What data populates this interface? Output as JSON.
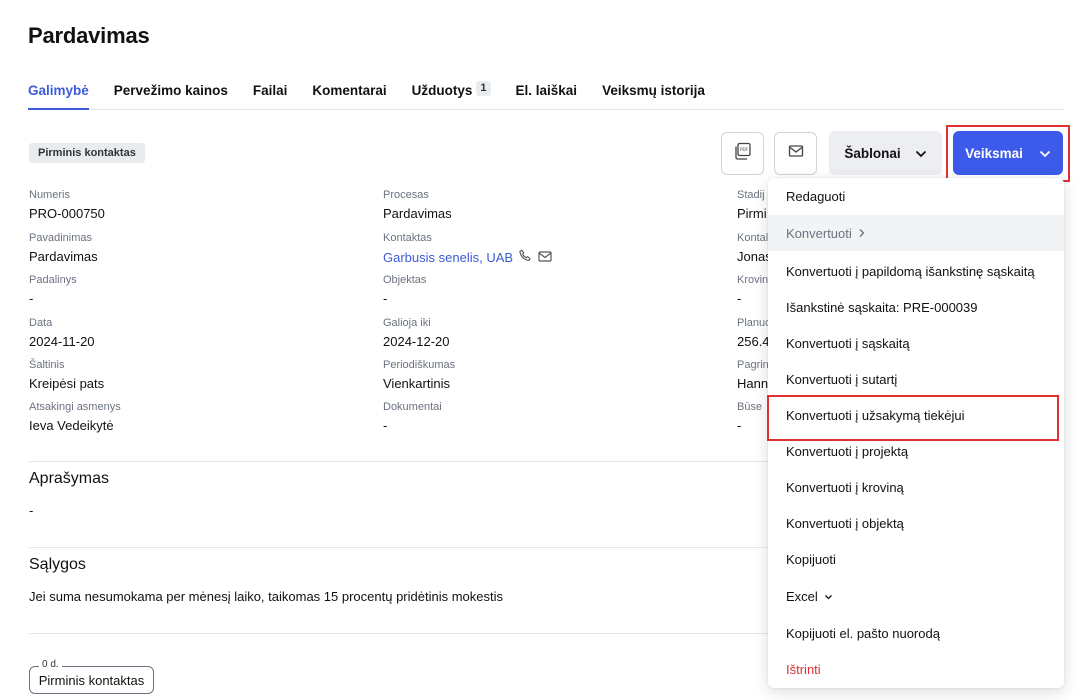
{
  "page": {
    "title": "Pardavimas"
  },
  "tabs": [
    {
      "label": "Galimybė",
      "active": true
    },
    {
      "label": "Pervežimo kainos"
    },
    {
      "label": "Failai"
    },
    {
      "label": "Komentarai"
    },
    {
      "label": "Užduotys",
      "badge": "1"
    },
    {
      "label": "El. laiškai"
    },
    {
      "label": "Veiksmų istorija"
    }
  ],
  "stage_chip": "Pirminis kontaktas",
  "toolbar": {
    "pdf_icon": "pdf-icon",
    "mail_icon": "mail-icon",
    "templates_label": "Šablonai",
    "actions_label": "Veiksmai",
    "accent": "#3c5bea"
  },
  "fields": {
    "col1": [
      {
        "label": "Numeris",
        "value": "PRO-000750"
      },
      {
        "label": "Pavadinimas",
        "value": "Pardavimas"
      },
      {
        "label": "Padalinys",
        "value": "-"
      },
      {
        "label": "Data",
        "value": "2024-11-20"
      },
      {
        "label": "Šaltinis",
        "value": "Kreipėsi pats"
      },
      {
        "label": "Atsakingi asmenys",
        "value": "Ieva Vedeikytė"
      }
    ],
    "col2": [
      {
        "label": "Procesas",
        "value": "Pardavimas"
      },
      {
        "label": "Kontaktas",
        "value": "Garbusis senelis, UAB"
      },
      {
        "label": "Objektas",
        "value": "-"
      },
      {
        "label": "Galioja iki",
        "value": "2024-12-20"
      },
      {
        "label": "Periodiškumas",
        "value": "Vienkartinis"
      },
      {
        "label": "Dokumentai",
        "value": "-"
      }
    ],
    "col3": [
      {
        "label": "Stadij",
        "value": "Pirmi"
      },
      {
        "label": "Kontal",
        "value": "Jonas"
      },
      {
        "label": "Krovin",
        "value": "-"
      },
      {
        "label": "Planuo",
        "value": "256.4"
      },
      {
        "label": "Pagrin",
        "value": "Hann"
      },
      {
        "label": "Būse",
        "value": "-"
      }
    ]
  },
  "description": {
    "title": "Aprašymas",
    "text": "-"
  },
  "conditions": {
    "title": "Sąlygos",
    "text": "Jei suma nesumokama per mėnesį laiko, taikomas 15 procentų pridėtinis mokestis"
  },
  "stage_box": {
    "days": "0 d.",
    "label": "Pirminis kontaktas"
  },
  "menu": {
    "items": [
      {
        "label": "Redaguoti"
      },
      {
        "label": "Konvertuoti",
        "submenu": true,
        "hover": true
      },
      {
        "label": "Konvertuoti į papildomą išankstinę sąskaitą"
      },
      {
        "label": "Išankstinė sąskaita: PRE-000039"
      },
      {
        "label": "Konvertuoti į sąskaitą"
      },
      {
        "label": "Konvertuoti į sutartį"
      },
      {
        "label": "Konvertuoti į užsakymą tiekėjui"
      },
      {
        "label": "Konvertuoti į projektą"
      },
      {
        "label": "Konvertuoti į kroviną"
      },
      {
        "label": "Konvertuoti į objektą"
      },
      {
        "label": "Kopijuoti"
      },
      {
        "label": "Excel",
        "dropdown": true
      },
      {
        "label": "Kopijuoti el. pašto nuorodą"
      },
      {
        "label": "Ištrinti",
        "danger": true
      }
    ]
  },
  "colors": {
    "highlight": "#e03131",
    "link": "#3b5bdb",
    "danger": "#e03131"
  }
}
